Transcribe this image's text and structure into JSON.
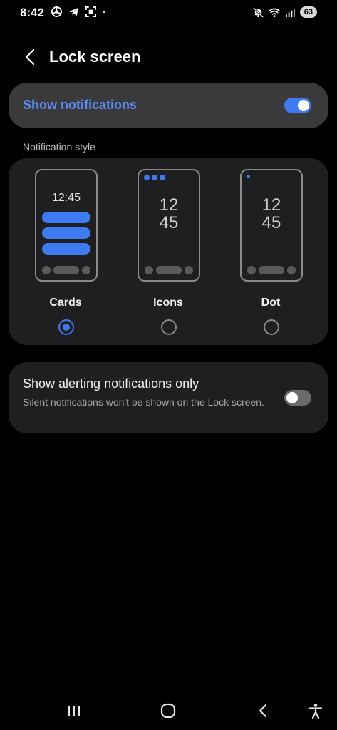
{
  "status_bar": {
    "time": "8:42",
    "battery": "63",
    "left_icons": [
      "chrome-icon",
      "telegram-icon",
      "screenshot-icon",
      "dot-icon"
    ],
    "right_icons": [
      "mute-icon",
      "wifi-icon",
      "signal-icon",
      "battery-icon"
    ]
  },
  "header": {
    "title": "Lock screen"
  },
  "show_notifications": {
    "label": "Show notifications",
    "enabled": true
  },
  "notification_style": {
    "section_label": "Notification style",
    "options": [
      {
        "label": "Cards",
        "preview_time": "12:45",
        "selected": true
      },
      {
        "label": "Icons",
        "preview_hour": "12",
        "preview_minute": "45",
        "selected": false
      },
      {
        "label": "Dot",
        "preview_hour": "12",
        "preview_minute": "45",
        "selected": false
      }
    ]
  },
  "alerting_only": {
    "title": "Show alerting notifications only",
    "subtitle": "Silent notifications won't be shown on the Lock screen.",
    "enabled": false
  },
  "nav_bar": {
    "icons": [
      "recents-icon",
      "home-icon",
      "back-icon",
      "accessibility-icon"
    ]
  },
  "colors": {
    "accent": "#3e7bf2",
    "accent_text": "#5b8ef5",
    "background": "#000000",
    "card": "#1f1f21",
    "card_highlight": "#3a3a3c"
  }
}
